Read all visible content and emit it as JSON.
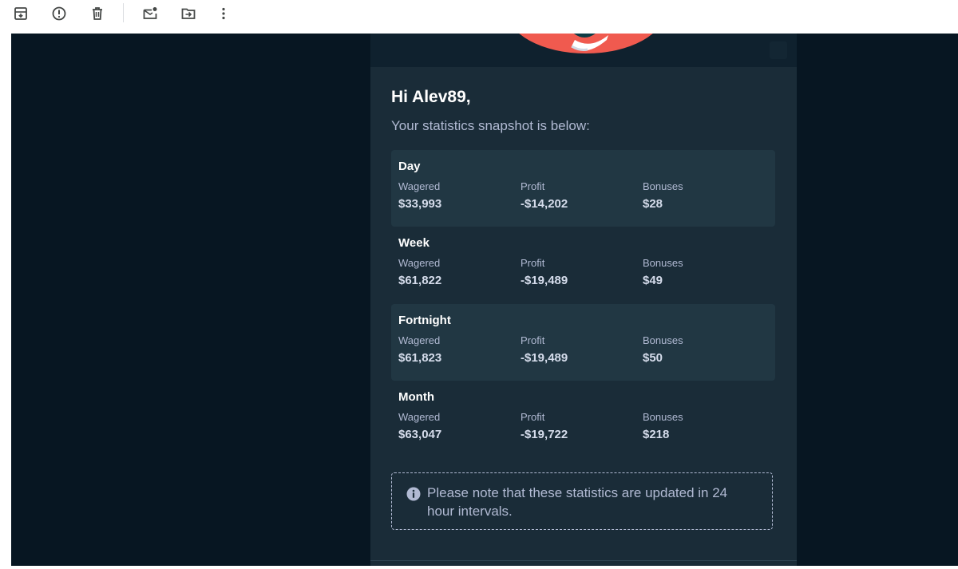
{
  "toolbar": {
    "icons": [
      "archive-icon",
      "report-spam-icon",
      "delete-icon",
      "mark-unread-icon",
      "move-to-icon",
      "more-options-icon"
    ]
  },
  "email": {
    "greeting": "Hi Alev89,",
    "intro": "Your statistics snapshot is below:",
    "stats": [
      {
        "period": "Day",
        "wagered_label": "Wagered",
        "wagered": "$33,993",
        "profit_label": "Profit",
        "profit": "-$14,202",
        "bonuses_label": "Bonuses",
        "bonuses": "$28"
      },
      {
        "period": "Week",
        "wagered_label": "Wagered",
        "wagered": "$61,822",
        "profit_label": "Profit",
        "profit": "-$19,489",
        "bonuses_label": "Bonuses",
        "bonuses": "$49"
      },
      {
        "period": "Fortnight",
        "wagered_label": "Wagered",
        "wagered": "$61,823",
        "profit_label": "Profit",
        "profit": "-$19,489",
        "bonuses_label": "Bonuses",
        "bonuses": "$50"
      },
      {
        "period": "Month",
        "wagered_label": "Wagered",
        "wagered": "$63,047",
        "profit_label": "Profit",
        "profit": "-$19,722",
        "bonuses_label": "Bonuses",
        "bonuses": "$218"
      }
    ],
    "note": "Please note that these statistics are updated in 24 hour intervals."
  },
  "colors": {
    "page_background": "#071622",
    "email_background": "#1a2c38",
    "row_highlight": "#213743",
    "text_muted": "#b1bad3",
    "header_accent": "#f05a4f"
  }
}
